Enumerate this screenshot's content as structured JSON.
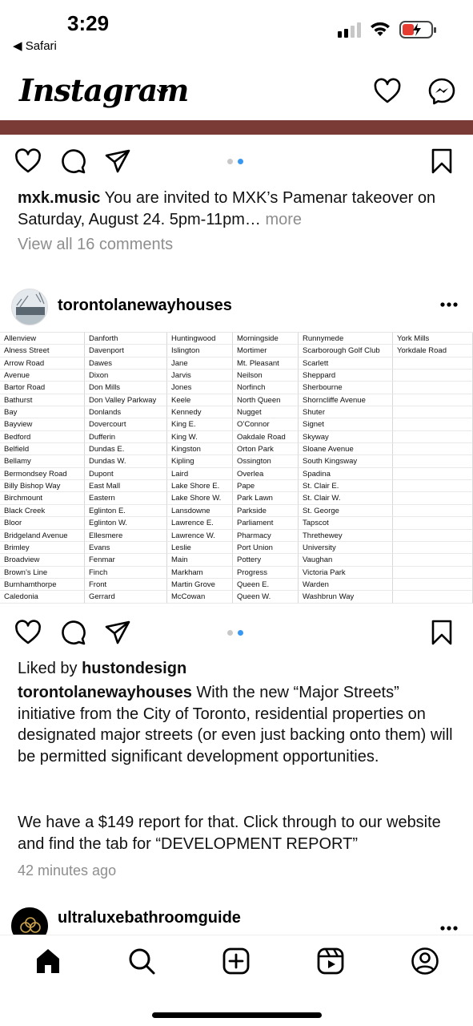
{
  "status_bar": {
    "time": "3:29",
    "back_app": "◀ Safari",
    "battery_color": "#e53b30"
  },
  "header": {
    "logo_text": "Instagram",
    "icons": [
      "chevron-down-icon",
      "heart-icon",
      "messenger-icon"
    ]
  },
  "post1": {
    "caption_username": "mxk.music",
    "caption_text": " You are invited to MXK’s Pamenar takeover on Saturday, August 24. 5pm-11pm… ",
    "more_label": "more",
    "comments_label": "View all 16 comments"
  },
  "post2": {
    "username": "torontolanewayhouses",
    "liked_prefix": "Liked by ",
    "liked_user": "hustondesign",
    "caption_username": "torontolanewayhouses",
    "caption_text": " With the new “Major Streets” initiative from the City of Toronto, residential properties on designated major streets (or even just backing onto them) will be permitted significant development opportunities.",
    "caption_text_2": "We have a $149 report for that.  Click through to our website and find the tab for “DEVELOPMENT REPORT”",
    "timestamp": "42 minutes ago",
    "street_table": [
      [
        "Allenview",
        "Alness Street",
        "Arrow Road",
        "Avenue",
        "Bartor Road",
        "Bathurst",
        "Bay",
        "Bayview",
        "Bedford",
        "Belfield",
        "Bellamy",
        "Bermondsey Road",
        "Billy Bishop Way",
        "Birchmount",
        "Black Creek",
        "Bloor",
        "Bridgeland Avenue",
        "Brimley",
        "Broadview",
        "Brown’s Line",
        "Burnhamthorpe",
        "Caledonia"
      ],
      [
        "Danforth",
        "Davenport",
        "Dawes",
        "Dixon",
        "Don Mills",
        "Don Valley Parkway",
        "Donlands",
        "Dovercourt",
        "Dufferin",
        "Dundas E.",
        "Dundas W.",
        "Dupont",
        "East Mall",
        "Eastern",
        "Eglinton E.",
        "Eglinton W.",
        "Ellesmere",
        "Evans",
        "Fenmar",
        "Finch",
        "Front",
        "Gerrard"
      ],
      [
        "Huntingwood",
        "Islington",
        "Jane",
        "Jarvis",
        "Jones",
        "Keele",
        "Kennedy",
        "King E.",
        "King W.",
        "Kingston",
        "Kipling",
        "Laird",
        "Lake Shore E.",
        "Lake Shore W.",
        "Lansdowne",
        "Lawrence E.",
        "Lawrence W.",
        "Leslie",
        "Main",
        "Markham",
        "Martin Grove",
        "McCowan"
      ],
      [
        "Morningside",
        "Mortimer",
        "Mt. Pleasant",
        "Neilson",
        "Norfinch",
        "North Queen",
        "Nugget",
        "O’Connor",
        "Oakdale Road",
        "Orton Park",
        "Ossington",
        "Overlea",
        "Pape",
        "Park Lawn",
        "Parkside",
        "Parliament",
        "Pharmacy",
        "Port Union",
        "Pottery",
        "Progress",
        "Queen E.",
        "Queen W."
      ],
      [
        "Runnymede",
        "Scarborough Golf Club",
        "Scarlett",
        "Sheppard",
        "Sherbourne",
        "Shorncliffe Avenue",
        "Shuter",
        "Signet",
        "Skyway",
        "Sloane Avenue",
        "South Kingsway",
        "Spadina",
        "St. Clair E.",
        "St. Clair W.",
        "St. George",
        "Tapscot",
        "Threthewey",
        "University",
        "Vaughan",
        "Victoria Park",
        "Warden",
        "Washbrun Way"
      ],
      [
        "York Mills",
        "Yorkdale Road",
        "",
        "",
        "",
        "",
        "",
        "",
        "",
        "",
        "",
        "",
        "",
        "",
        "",
        "",
        "",
        "",
        "",
        "",
        "",
        ""
      ]
    ]
  },
  "post3": {
    "username": "ultraluxebathroomguide"
  },
  "tab_bar": {
    "tabs": [
      "home-icon",
      "search-icon",
      "create-icon",
      "reels-icon",
      "profile-icon"
    ]
  }
}
